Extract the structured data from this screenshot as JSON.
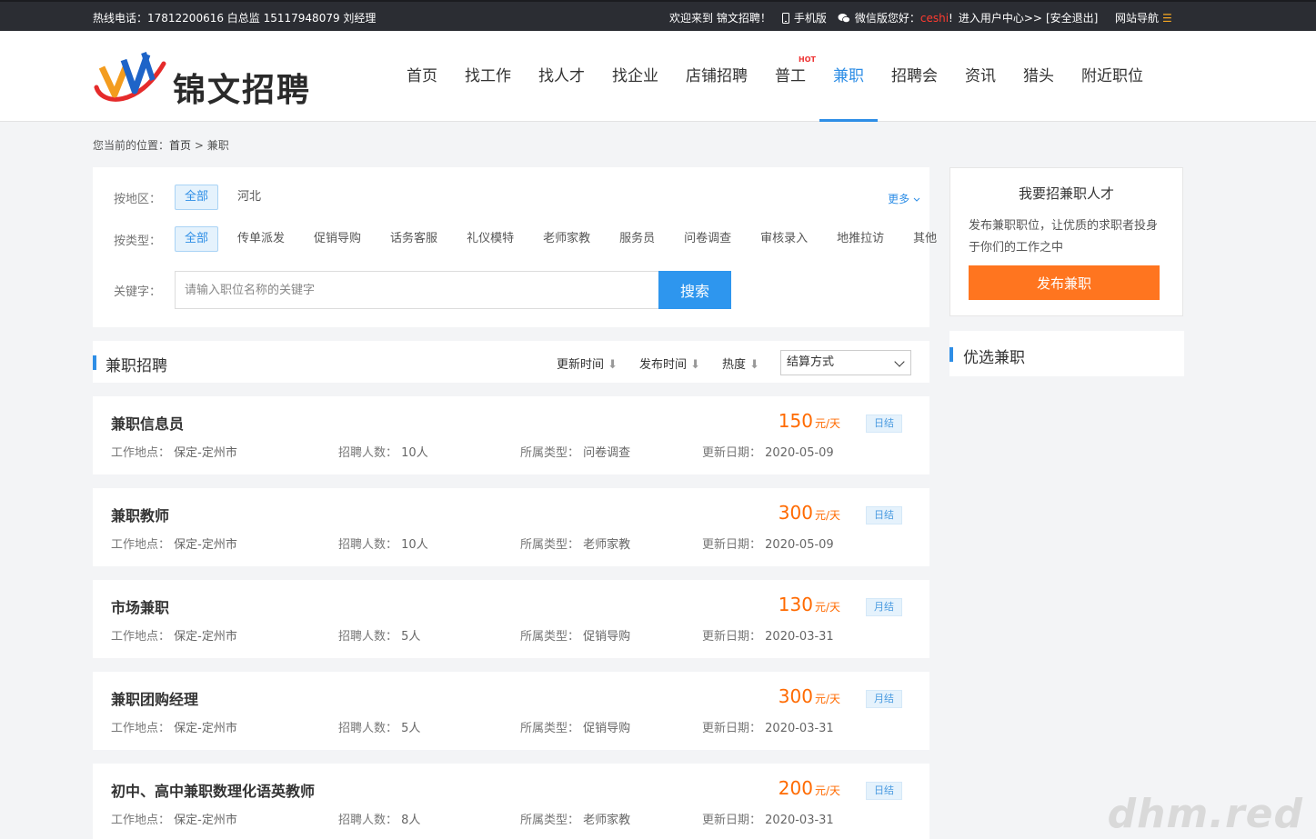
{
  "topbar": {
    "hotline": "热线电话：17812200616 白总监 15117948079 刘经理",
    "welcome": "欢迎来到 锦文招聘！",
    "mobile": "手机版",
    "wechat": "微信版",
    "hello_prefix": "您好：",
    "username": "ceshi",
    "hello_suffix": "!",
    "user_center": "进入用户中心>>",
    "logout": "[安全退出]",
    "sitemap": "网站导航",
    "sitemap_icon": "☰"
  },
  "header": {
    "logo_text": "锦文招聘",
    "nav": [
      {
        "label": "首页"
      },
      {
        "label": "找工作"
      },
      {
        "label": "找人才"
      },
      {
        "label": "找企业"
      },
      {
        "label": "店铺招聘"
      },
      {
        "label": "普工",
        "badge": "HOT"
      },
      {
        "label": "兼职",
        "active": true
      },
      {
        "label": "招聘会"
      },
      {
        "label": "资讯"
      },
      {
        "label": "猎头"
      },
      {
        "label": "附近职位"
      }
    ]
  },
  "breadcrumb": {
    "prefix": "您当前的位置：",
    "home": "首页",
    "sep": " > ",
    "current": "兼职"
  },
  "filters": {
    "area": {
      "label": "按地区：",
      "options": [
        "全部",
        "河北"
      ],
      "selected": "全部"
    },
    "more": "更多",
    "type": {
      "label": "按类型：",
      "options": [
        "全部",
        "传单派发",
        "促销导购",
        "话务客服",
        "礼仪模特",
        "老师家教",
        "服务员",
        "问卷调查",
        "审核录入",
        "地推拉访",
        "其他"
      ],
      "selected": "全部"
    },
    "keyword": {
      "label": "关键字：",
      "placeholder": "请输入职位名称的关键字",
      "button": "搜索"
    }
  },
  "list": {
    "title": "兼职招聘",
    "sort": [
      "更新时间",
      "发布时间",
      "热度"
    ],
    "settle_select": "结算方式",
    "meta_labels": {
      "location": "工作地点：",
      "count": "招聘人数：",
      "type": "所属类型：",
      "date": "更新日期："
    },
    "jobs": [
      {
        "title": "兼职信息员",
        "salary": "150",
        "unit": "元/天",
        "settle": "日结",
        "location": "保定-定州市",
        "count": "10人",
        "type": "问卷调查",
        "date": "2020-05-09"
      },
      {
        "title": "兼职教师",
        "salary": "300",
        "unit": "元/天",
        "settle": "日结",
        "location": "保定-定州市",
        "count": "10人",
        "type": "老师家教",
        "date": "2020-05-09"
      },
      {
        "title": "市场兼职",
        "salary": "130",
        "unit": "元/天",
        "settle": "月结",
        "location": "保定-定州市",
        "count": "5人",
        "type": "促销导购",
        "date": "2020-03-31"
      },
      {
        "title": "兼职团购经理",
        "salary": "300",
        "unit": "元/天",
        "settle": "月结",
        "location": "保定-定州市",
        "count": "5人",
        "type": "促销导购",
        "date": "2020-03-31"
      },
      {
        "title": "初中、高中兼职数理化语英教师",
        "salary": "200",
        "unit": "元/天",
        "settle": "日结",
        "location": "保定-定州市",
        "count": "8人",
        "type": "老师家教",
        "date": "2020-03-31"
      }
    ]
  },
  "sidebar": {
    "recruit_title": "我要招兼职人才",
    "recruit_desc": "发布兼职职位，让优质的求职者投身于你们的工作之中",
    "publish_button": "发布兼职",
    "featured_title": "优选兼职"
  },
  "watermark": "dhm.red",
  "colors": {
    "accent": "#2e8ee6",
    "salary": "#ff6a00",
    "publish": "#ff751f",
    "topbar": "#2b2d33"
  }
}
